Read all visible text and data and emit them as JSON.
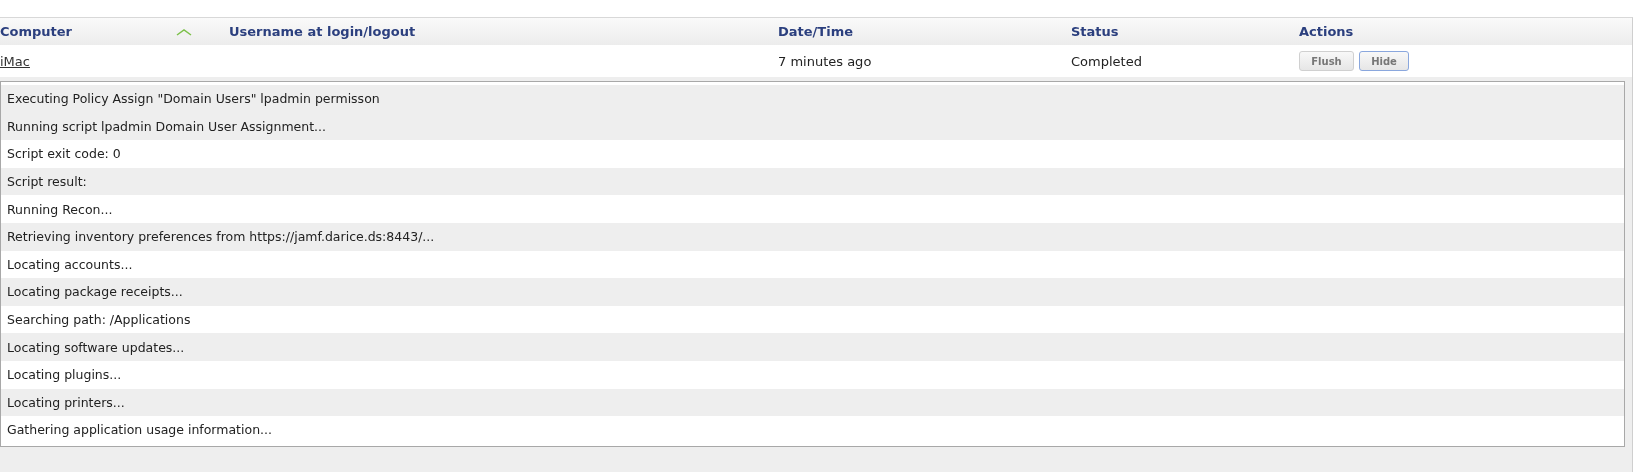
{
  "table": {
    "columns": [
      {
        "label": "Computer",
        "sorted_ascending": true
      },
      {
        "label": "Username at login/logout"
      },
      {
        "label": "Date/Time"
      },
      {
        "label": "Status"
      },
      {
        "label": "Actions"
      }
    ],
    "rows": [
      {
        "computer": "iMac",
        "datetime": "7 minutes ago",
        "status": "Completed",
        "actions": [
          {
            "label": "Flush",
            "selected": false
          },
          {
            "label": "Hide",
            "selected": true
          }
        ],
        "log": [
          "Executing Policy Assign \"Domain Users\" lpadmin permisson",
          "Running script lpadmin Domain User Assignment...",
          "Script exit code: 0",
          "Script result:",
          "Running Recon...",
          "Retrieving inventory preferences from https://jamf.darice.ds:8443/...",
          "Locating accounts...",
          "Locating package receipts...",
          "Searching path: /Applications",
          "Locating software updates...",
          "Locating plugins...",
          "Locating printers...",
          "Gathering application usage information..."
        ]
      }
    ]
  }
}
